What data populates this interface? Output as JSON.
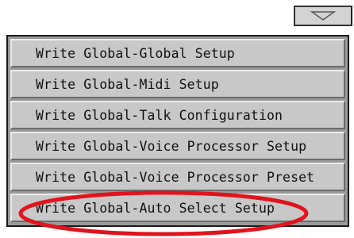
{
  "dropdown": {
    "toggle_icon": "triangle-down-icon",
    "items": [
      {
        "label": "Write Global-Global Setup"
      },
      {
        "label": "Write Global-Midi Setup"
      },
      {
        "label": "Write Global-Talk Configuration"
      },
      {
        "label": "Write Global-Voice Processor Setup"
      },
      {
        "label": "Write Global-Voice Processor Preset"
      },
      {
        "label": "Write Global-Auto Select Setup"
      }
    ]
  },
  "annotation": {
    "color": "#e0141e",
    "shape": "ellipse",
    "target": "Write Global-Auto Select Setup"
  }
}
